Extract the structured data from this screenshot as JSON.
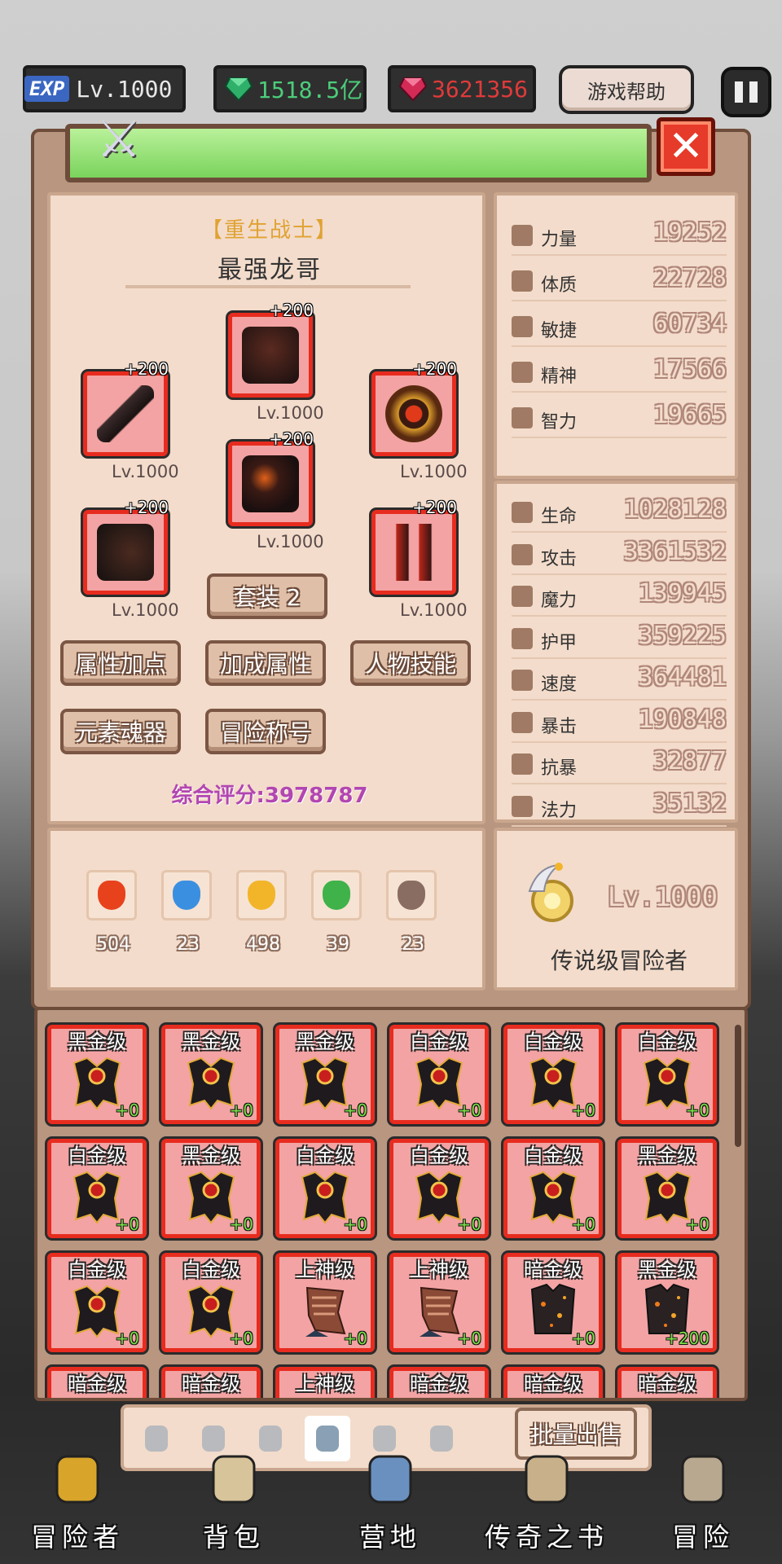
{
  "top": {
    "exp_badge": "EXP",
    "level": "Lv.1000",
    "green_gem": "1518.5亿",
    "red_gem": "3621356",
    "help": "游戏帮助"
  },
  "character": {
    "class": "【重生战士】",
    "name": "最强龙哥",
    "score": "综合评分:3978787",
    "slots": [
      {
        "name": "helmet",
        "plus": "+200",
        "lv": "Lv.1000"
      },
      {
        "name": "weapon",
        "plus": "+200",
        "lv": "Lv.1000"
      },
      {
        "name": "shield",
        "plus": "+200",
        "lv": "Lv.1000"
      },
      {
        "name": "armor",
        "plus": "+200",
        "lv": "Lv.1000"
      },
      {
        "name": "gloves",
        "plus": "+200",
        "lv": "Lv.1000"
      },
      {
        "name": "boots",
        "plus": "+200",
        "lv": "Lv.1000"
      }
    ],
    "set_button": "套装 2",
    "buttons": [
      "属性加点",
      "加成属性",
      "人物技能",
      "元素魂器",
      "冒险称号"
    ]
  },
  "base_stats": [
    {
      "name": "力量",
      "value": "19252"
    },
    {
      "name": "体质",
      "value": "22728"
    },
    {
      "name": "敏捷",
      "value": "60734"
    },
    {
      "name": "精神",
      "value": "17566"
    },
    {
      "name": "智力",
      "value": "19665"
    }
  ],
  "combat_stats": [
    {
      "name": "生命",
      "value": "1028128"
    },
    {
      "name": "攻击",
      "value": "3361532"
    },
    {
      "name": "魔力",
      "value": "139945"
    },
    {
      "name": "护甲",
      "value": "359225"
    },
    {
      "name": "速度",
      "value": "364481"
    },
    {
      "name": "暴击",
      "value": "190848"
    },
    {
      "name": "抗暴",
      "value": "32877"
    },
    {
      "name": "法力",
      "value": "35132"
    }
  ],
  "elements": [
    {
      "icon": "fire-icon",
      "count": "504",
      "color": "#e8421c"
    },
    {
      "icon": "water-icon",
      "count": "23",
      "color": "#3b8fe0"
    },
    {
      "icon": "gold-icon",
      "count": "498",
      "color": "#f2b52a"
    },
    {
      "icon": "leaf-icon",
      "count": "39",
      "color": "#3fb24a"
    },
    {
      "icon": "skull-icon",
      "count": "23",
      "color": "#8a6d62"
    }
  ],
  "rank": {
    "level": "Lv.1000",
    "title": "传说级冒险者"
  },
  "inventory": [
    {
      "grade": "黑金级",
      "enh": "+0",
      "kind": "chest"
    },
    {
      "grade": "黑金级",
      "enh": "+0",
      "kind": "chest"
    },
    {
      "grade": "黑金级",
      "enh": "+0",
      "kind": "chest"
    },
    {
      "grade": "白金级",
      "enh": "+0",
      "kind": "chest"
    },
    {
      "grade": "白金级",
      "enh": "+0",
      "kind": "chest"
    },
    {
      "grade": "白金级",
      "enh": "+0",
      "kind": "chest"
    },
    {
      "grade": "白金级",
      "enh": "+0",
      "kind": "chest"
    },
    {
      "grade": "黑金级",
      "enh": "+0",
      "kind": "chest"
    },
    {
      "grade": "白金级",
      "enh": "+0",
      "kind": "chest"
    },
    {
      "grade": "白金级",
      "enh": "+0",
      "kind": "chest"
    },
    {
      "grade": "白金级",
      "enh": "+0",
      "kind": "chest"
    },
    {
      "grade": "黑金级",
      "enh": "+0",
      "kind": "chest"
    },
    {
      "grade": "白金级",
      "enh": "+0",
      "kind": "chest"
    },
    {
      "grade": "白金级",
      "enh": "+0",
      "kind": "chest"
    },
    {
      "grade": "上神级",
      "enh": "+0",
      "kind": "bone"
    },
    {
      "grade": "上神级",
      "enh": "+0",
      "kind": "bone"
    },
    {
      "grade": "暗金级",
      "enh": "+0",
      "kind": "lava"
    },
    {
      "grade": "黑金级",
      "enh": "+200",
      "kind": "lava"
    },
    {
      "grade": "暗金级",
      "enh": "",
      "kind": "chest"
    },
    {
      "grade": "暗金级",
      "enh": "",
      "kind": "chest"
    },
    {
      "grade": "上神级",
      "enh": "",
      "kind": "bone"
    },
    {
      "grade": "暗金级",
      "enh": "",
      "kind": "chest"
    },
    {
      "grade": "暗金级",
      "enh": "",
      "kind": "chest"
    },
    {
      "grade": "暗金级",
      "enh": "",
      "kind": "chest"
    }
  ],
  "tabs": [
    "sword-icon",
    "shield-icon",
    "helmet-icon",
    "armor-icon",
    "pants-icon",
    "ring-icon"
  ],
  "sell_button": "批量出售",
  "nav": [
    "冒险者",
    "背包",
    "营地",
    "传奇之书",
    "冒险"
  ]
}
